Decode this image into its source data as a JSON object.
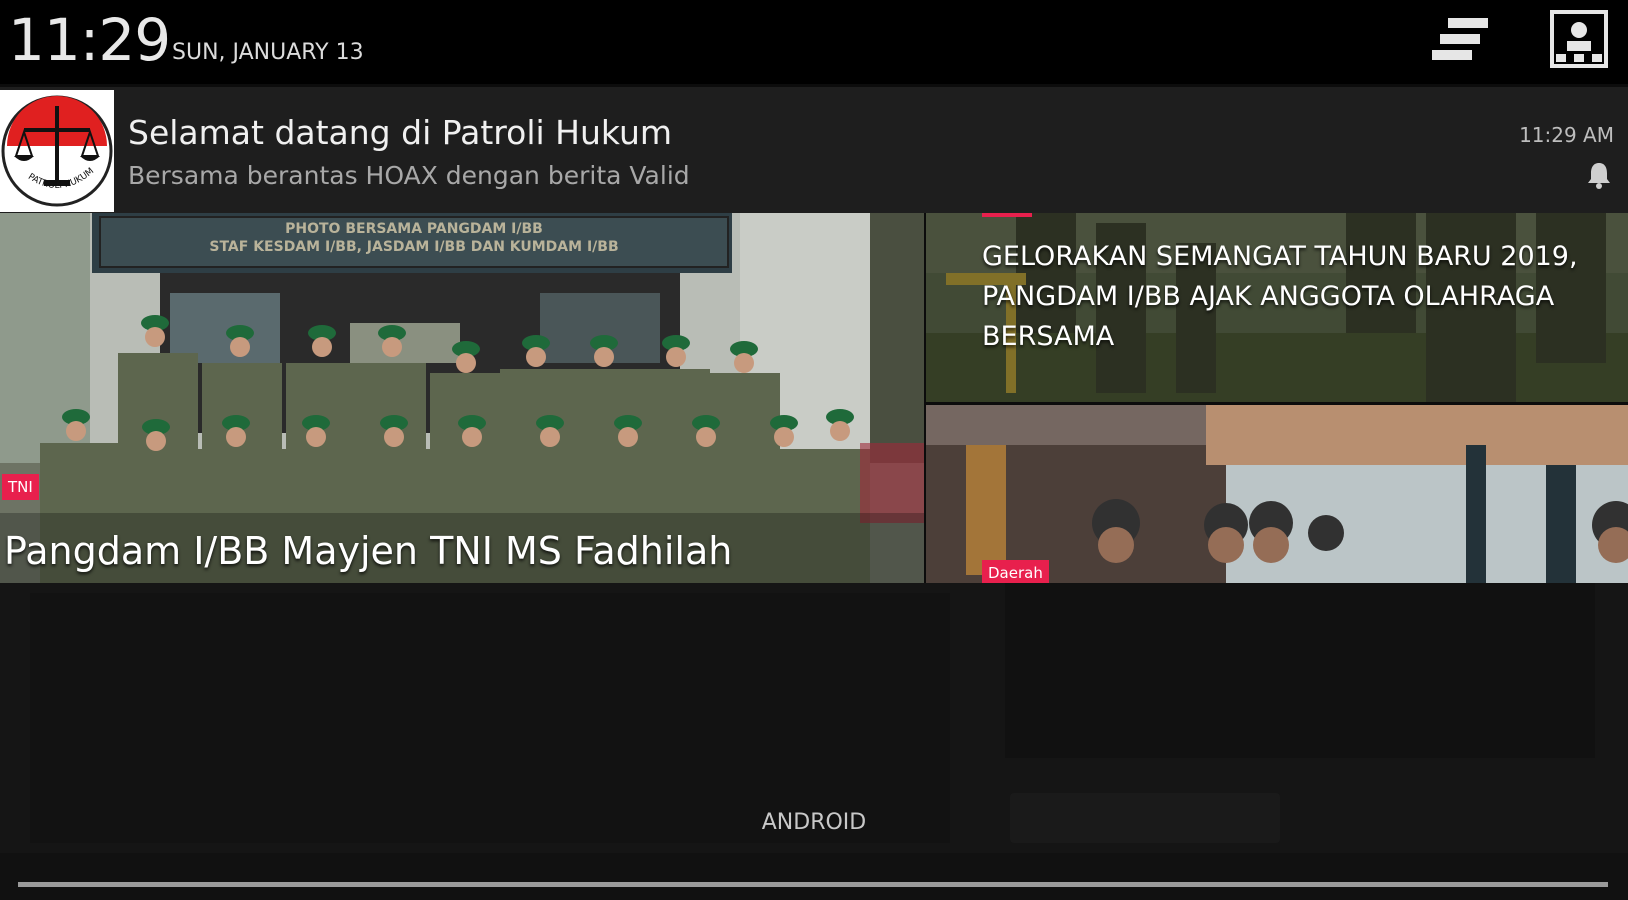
{
  "status_bar": {
    "time": "11:29",
    "date": "SUN, JANUARY 13",
    "settings_icon": "quick-settings-icon",
    "user_icon": "user-switch-icon"
  },
  "notification": {
    "app_icon": "patroli-hukum-logo",
    "logo_text": "PATROLI HUKUM",
    "title": "Selamat datang di Patroli Hukum",
    "text": "Bersama berantas HOAX dengan berita Valid",
    "time": "11:29 AM",
    "bell_icon": "bell-icon"
  },
  "news": {
    "main": {
      "tag": "TNI",
      "headline": "Pangdam I/BB Mayjen TNI MS Fadhilah",
      "banner_line1": "PHOTO BERSAMA PANGDAM I/BB",
      "banner_line2": "STAF KESDAM I/BB, JASDAM I/BB DAN KUMDAM I/BB"
    },
    "top_right": {
      "headline": "GELORAKAN SEMANGAT TAHUN BARU 2019, PANGDAM I/BB AJAK ANGGOTA OLAHRAGA BERSAMA"
    },
    "bottom_right": {
      "tag": "Daerah"
    }
  },
  "footer": {
    "label": "ANDROID"
  },
  "colors": {
    "accent": "#e8204d",
    "status_bar": "#000000",
    "notification_bg": "#1e1e1e"
  }
}
